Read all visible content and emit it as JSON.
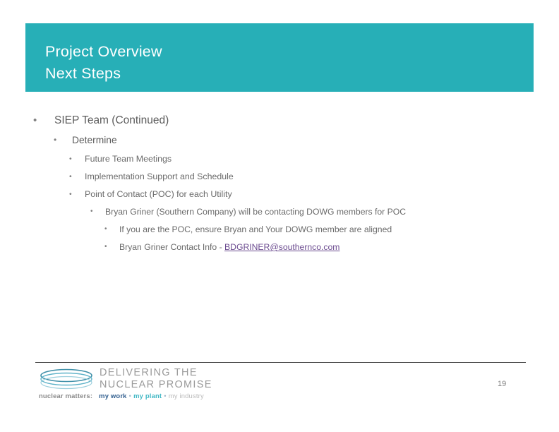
{
  "slide": {
    "title": {
      "line1": "Project Overview",
      "line2": "Next Steps"
    },
    "banner_color": "#27afb7",
    "body": [
      {
        "level": 1,
        "marker": "•",
        "text": "SIEP Team (Continued)"
      },
      {
        "level": 2,
        "marker": "•",
        "text": "Determine"
      },
      {
        "level": 3,
        "marker": "•",
        "text": "Future Team Meetings"
      },
      {
        "level": 3,
        "marker": "•",
        "text": "Implementation Support and Schedule"
      },
      {
        "level": 3,
        "marker": "•",
        "text": "Point of Contact (POC) for each Utility"
      },
      {
        "level": 4,
        "marker": "•",
        "text": "Bryan Griner (Southern Company) will be contacting DOWG members for  POC"
      },
      {
        "level": 5,
        "marker": "•",
        "text": "If you are the POC, ensure Bryan and Your DOWG member are  aligned"
      },
      {
        "level": 5,
        "marker": "•",
        "text_before_link": "Bryan Griner Contact Info - ",
        "link_text": "BDGRINER@southernco.com",
        "link_color": "#6c4c90"
      }
    ],
    "footer": {
      "logo": {
        "word_line1": "DELIVERING  THE",
        "word_line2": "NUCLEAR PROMISE",
        "tagline_label": "nuclear matters:",
        "tagline_work": "my work",
        "tagline_sep1": "•",
        "tagline_plant": "my plant",
        "tagline_sep2": "•",
        "tagline_industry": "my industry"
      },
      "page_number": "19"
    }
  }
}
